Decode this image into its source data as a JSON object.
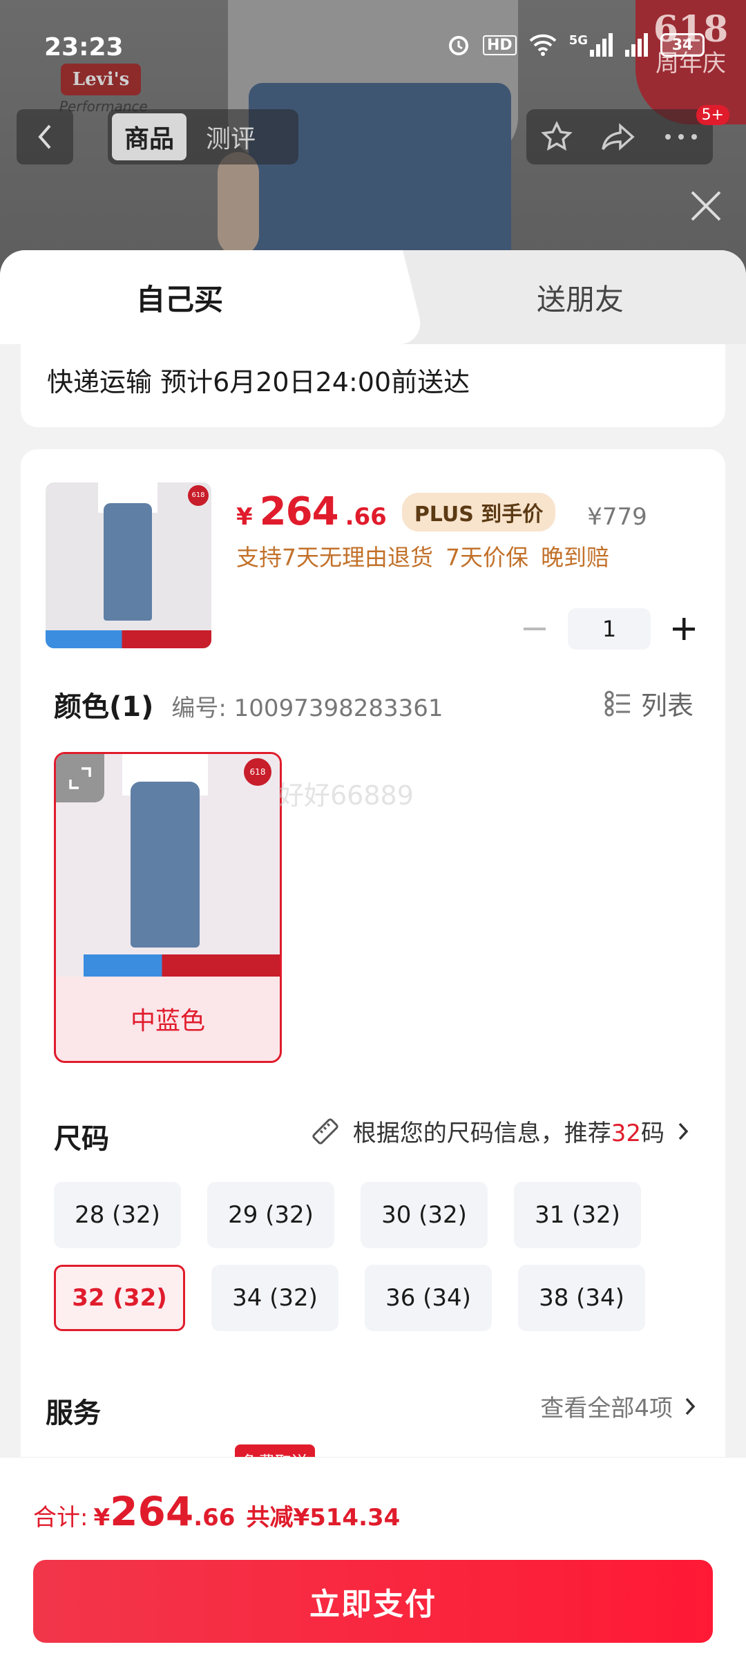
{
  "status_bar": {
    "time": "23:23",
    "battery": "34",
    "network": "5G",
    "hd": "HD"
  },
  "background": {
    "brand_logo": "Levi's",
    "brand_sub": "Performance",
    "promo_badge_number": "618",
    "promo_badge_text": "周年庆"
  },
  "nav": {
    "tabs": [
      "商品",
      "测评"
    ],
    "active_tab": "商品",
    "notification_badge": "5+"
  },
  "purchase_tabs": {
    "self": "自己买",
    "friend": "送朋友"
  },
  "delivery": {
    "text": "快递运输 预计6月20日24:00前送达"
  },
  "product": {
    "price_currency": "¥",
    "price_int": "264",
    "price_dec": ".66",
    "plus_tag": "PLUS 到手价",
    "original_price": "¥779",
    "guarantees": [
      "支持7天无理由退货",
      "7天价保",
      "晚到赔"
    ],
    "thumb_badge": "618"
  },
  "quantity": {
    "value": "1"
  },
  "color": {
    "title": "颜色(1)",
    "sku": "编号: 10097398283361",
    "list_label": "列表",
    "selected_label": "中蓝色",
    "watermark": "好好66889"
  },
  "size": {
    "title": "尺码",
    "recommend_prefix": "根据您的尺码信息，推荐",
    "recommend_size": "32",
    "recommend_suffix": "码",
    "options": [
      "28 (32)",
      "29 (32)",
      "30 (32)",
      "31 (32)",
      "32 (32)",
      "34 (32)",
      "36 (34)",
      "38 (34)"
    ],
    "selected": "32 (32)"
  },
  "service": {
    "title": "服务",
    "view_all": "查看全部4项",
    "free_tag": "免费取送"
  },
  "summary": {
    "label": "合计:",
    "currency": "¥",
    "total_int": "264",
    "total_dec": ".66",
    "saved": "共减¥514.34"
  },
  "pay_button": "立即支付",
  "colors": {
    "accent": "#e01c2c",
    "plus_tag_bg": "#f8e3cc",
    "guarantee": "#c2712a"
  }
}
